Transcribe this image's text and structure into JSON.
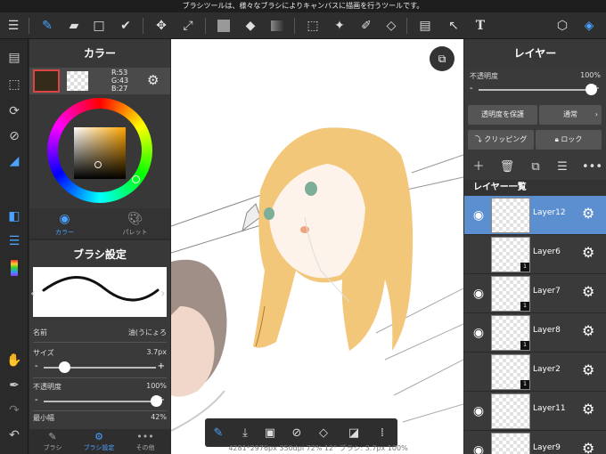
{
  "statusbar": {
    "text": "ブラシツールは、様々なブラシによりキャンバスに描画を行うツールです。"
  },
  "toolbar": {
    "icons": [
      "menu-icon",
      "brush-icon",
      "eraser-icon",
      "rect-icon",
      "checkmark-icon",
      "move-icon",
      "transform-icon",
      "fill-rect-icon",
      "bucket-icon",
      "gradient-icon",
      "selection-icon",
      "magic-wand-icon",
      "select-pen-icon",
      "select-eraser-icon",
      "layout-icon",
      "select-arrow-icon",
      "text-icon",
      "cube-icon",
      "layers-icon"
    ]
  },
  "color_panel": {
    "title": "カラー",
    "rgb_r": "R:53",
    "rgb_g": "G:43",
    "rgb_b": "B:27",
    "main_color": "#352b1b",
    "tabs": [
      {
        "label": "カラー"
      },
      {
        "label": "パレット"
      }
    ]
  },
  "brush_panel": {
    "title": "ブラシ設定",
    "name_label": "名前",
    "name_value": "油(うにょろ",
    "size_label": "サイズ",
    "size_value": "3.7px",
    "size_level": 0.18,
    "opacity_label": "不透明度",
    "opacity_value": "100%",
    "opacity_level": 1.0,
    "minwidth_label": "最小幅",
    "minwidth_value": "42%",
    "tabs": [
      {
        "label": "ブラシ"
      },
      {
        "label": "ブラシ設定"
      },
      {
        "label": "その他"
      }
    ]
  },
  "canvas": {
    "info": "4281*2976px 350dpi 72% 12° ブラシ: 3.7px 100%"
  },
  "layer_panel": {
    "title": "レイヤー",
    "opacity_label": "不透明度",
    "opacity_value": "100%",
    "opacity_level": 1.0,
    "protect_label": "透明度を保護",
    "blend_label": "通常",
    "clipping_label": "クリッピング",
    "lock_label": "ロック",
    "list_title": "レイヤー一覧",
    "layers": [
      {
        "name": "Layer12",
        "visible": true,
        "selected": true,
        "badge": ""
      },
      {
        "name": "Layer6",
        "visible": false,
        "selected": false,
        "badge": "1"
      },
      {
        "name": "Layer7",
        "visible": true,
        "selected": false,
        "badge": "1"
      },
      {
        "name": "Layer8",
        "visible": true,
        "selected": false,
        "badge": "1"
      },
      {
        "name": "Layer2",
        "visible": false,
        "selected": false,
        "badge": "1"
      },
      {
        "name": "Layer11",
        "visible": true,
        "selected": false,
        "badge": ""
      },
      {
        "name": "Layer9",
        "visible": true,
        "selected": false,
        "badge": ""
      }
    ]
  },
  "colors": {
    "accent": "#4aa3ff",
    "selected_layer": "#5b8fd0"
  }
}
